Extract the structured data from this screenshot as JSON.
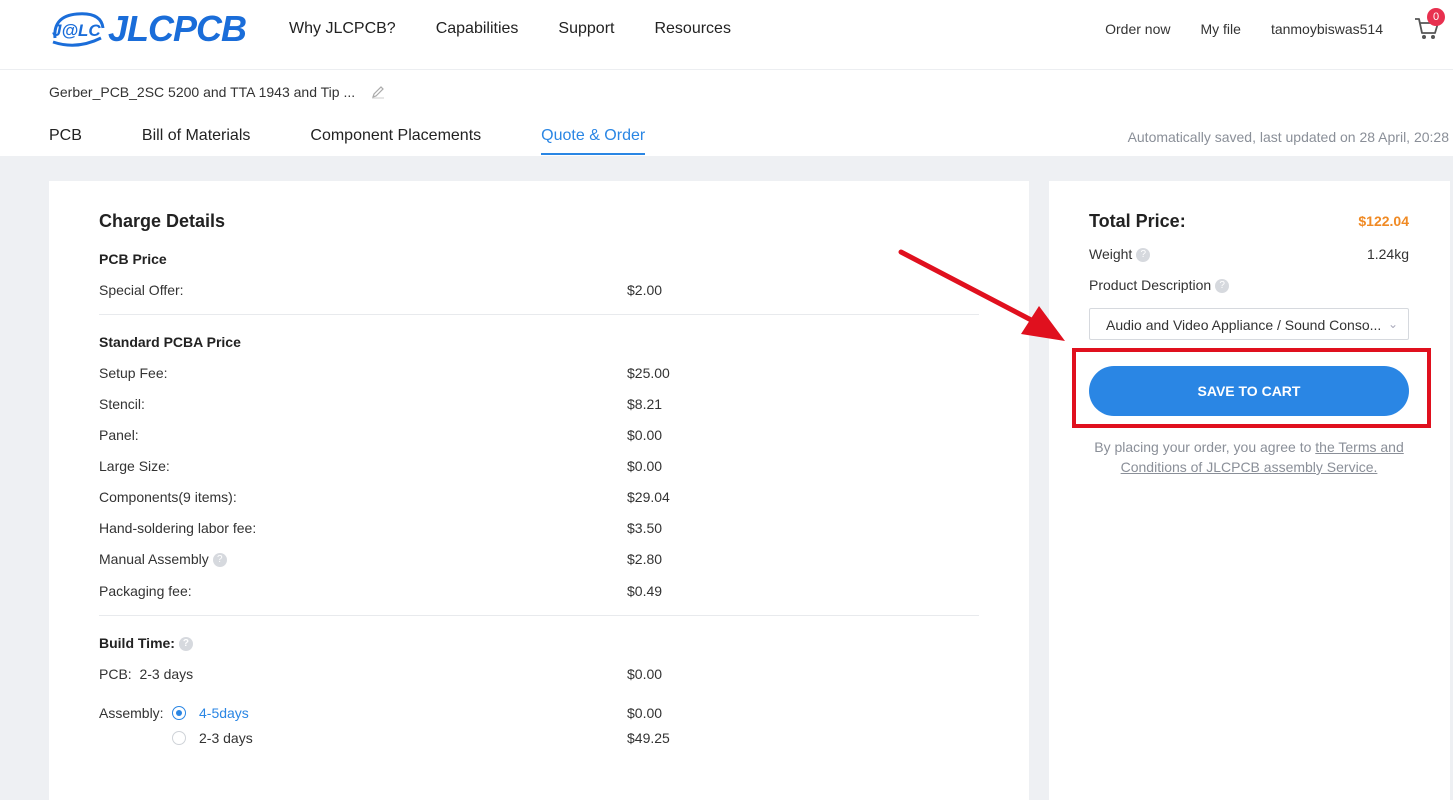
{
  "header": {
    "logo_badge": "J@LC",
    "logo_text": "JLCPCB",
    "nav": [
      "Why JLCPCB?",
      "Capabilities",
      "Support",
      "Resources"
    ],
    "order_now": "Order now",
    "my_file": "My file",
    "username": "tanmoybiswas514",
    "cart_count": "0"
  },
  "subheader": {
    "filename": "Gerber_PCB_2SC 5200 and TTA 1943 and Tip ...",
    "tabs": [
      "PCB",
      "Bill of Materials",
      "Component Placements",
      "Quote & Order"
    ],
    "active_tab": "Quote & Order",
    "autosave": "Automatically saved, last updated on 28 April, 20:28"
  },
  "charges": {
    "title": "Charge Details",
    "pcb_price_heading": "PCB Price",
    "special_offer_label": "Special Offer:",
    "special_offer_value": "$2.00",
    "pcba_heading": "Standard PCBA Price",
    "setup_fee_label": "Setup Fee:",
    "setup_fee_value": "$25.00",
    "stencil_label": "Stencil:",
    "stencil_value": "$8.21",
    "panel_label": "Panel:",
    "panel_value": "$0.00",
    "large_size_label": "Large Size:",
    "large_size_value": "$0.00",
    "components_label": "Components(9 items):",
    "components_value": "$29.04",
    "hand_soldering_label": "Hand-soldering labor fee:",
    "hand_soldering_value": "$3.50",
    "manual_assembly_label": "Manual Assembly",
    "manual_assembly_value": "$2.80",
    "packaging_label": "Packaging fee:",
    "packaging_value": "$0.49",
    "build_time_heading": "Build Time:",
    "pcb_build_label": "PCB:",
    "pcb_build_days": "2-3 days",
    "pcb_build_value": "$0.00",
    "assembly_label": "Assembly:",
    "assembly_option1": "4-5days",
    "assembly_option1_value": "$0.00",
    "assembly_option2": "2-3 days",
    "assembly_option2_value": "$49.25"
  },
  "summary": {
    "total_label": "Total Price:",
    "total_value": "$122.04",
    "weight_label": "Weight",
    "weight_value": "1.24kg",
    "product_desc_label": "Product Description",
    "product_desc_value": "Audio and Video Appliance / Sound Conso...",
    "save_button": "SAVE TO CART",
    "terms_prefix": "By placing your order, you agree to ",
    "terms_link": "the Terms and Conditions of JLCPCB assembly Service."
  },
  "colors": {
    "accent": "#2a86e4",
    "price": "#f08a24",
    "annotation": "#e0101e"
  }
}
